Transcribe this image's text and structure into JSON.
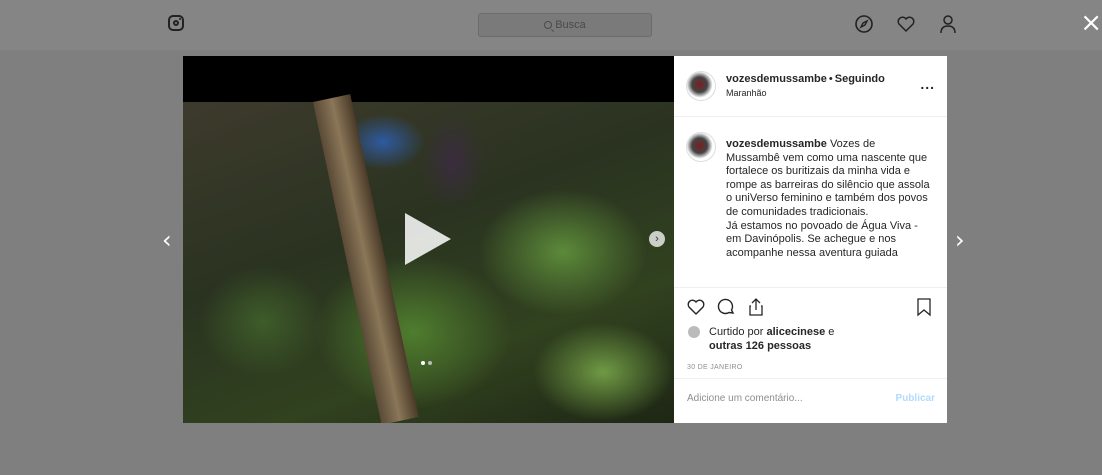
{
  "topbar": {
    "search_placeholder": "Busca",
    "icons": [
      "instagram-logo-icon",
      "search-icon",
      "compass-icon",
      "heart-icon",
      "profile-icon"
    ]
  },
  "close_glyph": "×",
  "nav": {
    "prev": "‹",
    "next": "›"
  },
  "post": {
    "username": "vozesdemussambe",
    "separator": "•",
    "follow_status": "Seguindo",
    "location": "Maranhão",
    "more": "...",
    "caption_username": "vozesdemussambe",
    "caption_text": " Vozes de Mussambê vem como uma nascente que fortalece os buritizais da minha vida e rompe as barreiras do silêncio que assola o uniVerso feminino e também dos povos de comunidades tradicionais.\nJá estamos no povoado de Água Viva - em Davinópolis. Se achegue e nos acompanhe nessa aventura guiada",
    "likes_prefix": "Curtido por ",
    "likes_user": "alicecinese",
    "likes_connector": " e",
    "likes_others": "outras 126 pessoas",
    "date": "30 DE JANEIRO",
    "comment_placeholder": "Adicione um comentário...",
    "publish_label": "Publicar"
  },
  "colors": {
    "overlay": "#7f7f7f",
    "panel": "#ffffff",
    "publish": "#b3dbff",
    "text": "#262626",
    "muted": "#8e8e8e"
  }
}
